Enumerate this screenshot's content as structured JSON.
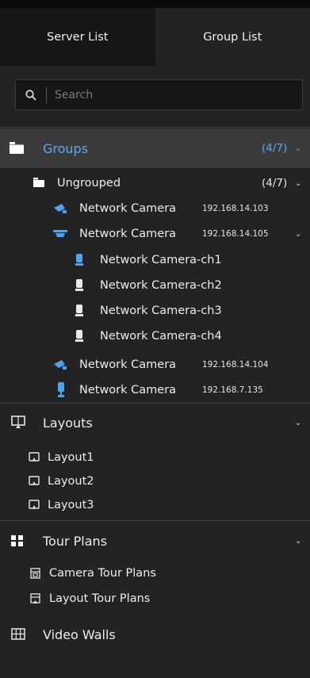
{
  "tabs": [
    {
      "label": "Server List",
      "active": false
    },
    {
      "label": "Group List",
      "active": true
    }
  ],
  "search": {
    "placeholder": "Search",
    "value": ""
  },
  "groups": {
    "label": "Groups",
    "count": "(4/7)",
    "accent": "#5da7f0",
    "children": [
      {
        "label": "Ungrouped",
        "count": "(4/7)",
        "devices": [
          {
            "label": "Network Camera",
            "ip": "192.168.14.103",
            "icon": "ptz-camera-icon"
          },
          {
            "label": "Network Camera",
            "ip": "192.168.14.105",
            "icon": "dome-camera-icon",
            "channels": [
              "Network Camera-ch1",
              "Network Camera-ch2",
              "Network Camera-ch3",
              "Network Camera-ch4"
            ]
          },
          {
            "label": "Network Camera",
            "ip": "192.168.14.104",
            "icon": "ptz-camera-icon"
          },
          {
            "label": "Network Camera",
            "ip": "192.168.7.135",
            "icon": "bullet-camera-icon"
          }
        ]
      }
    ]
  },
  "layouts": {
    "label": "Layouts",
    "items": [
      "Layout1",
      "Layout2",
      "Layout3"
    ]
  },
  "tour_plans": {
    "label": "Tour Plans",
    "items": [
      "Camera Tour Plans",
      "Layout Tour Plans"
    ]
  },
  "video_walls": {
    "label": "Video Walls"
  }
}
